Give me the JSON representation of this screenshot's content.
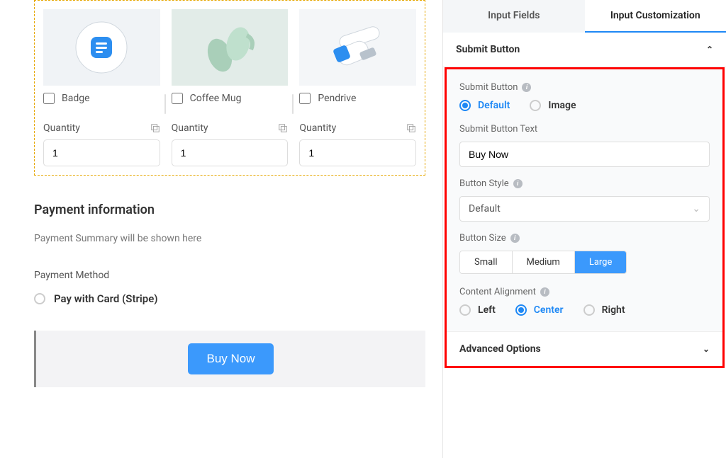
{
  "products": [
    {
      "name": "Badge",
      "qty_label": "Quantity",
      "qty_value": "1"
    },
    {
      "name": "Coffee Mug",
      "qty_label": "Quantity",
      "qty_value": "1"
    },
    {
      "name": "Pendrive",
      "qty_label": "Quantity",
      "qty_value": "1"
    }
  ],
  "payment_info_title": "Payment information",
  "payment_summary_text": "Payment Summary will be shown here",
  "payment_method_label": "Payment Method",
  "payment_method_option": "Pay with Card (Stripe)",
  "buy_button": "Buy Now",
  "tabs": {
    "input_fields": "Input Fields",
    "input_customization": "Input Customization"
  },
  "accordion": {
    "submit_button_title": "Submit Button",
    "advanced_options_title": "Advanced Options"
  },
  "settings": {
    "submit_button_label": "Submit Button",
    "submit_button_default": "Default",
    "submit_button_image": "Image",
    "submit_button_text_label": "Submit Button Text",
    "submit_button_text_value": "Buy Now",
    "button_style_label": "Button Style",
    "button_style_value": "Default",
    "button_size_label": "Button Size",
    "button_size_small": "Small",
    "button_size_medium": "Medium",
    "button_size_large": "Large",
    "content_alignment_label": "Content Alignment",
    "align_left": "Left",
    "align_center": "Center",
    "align_right": "Right"
  }
}
